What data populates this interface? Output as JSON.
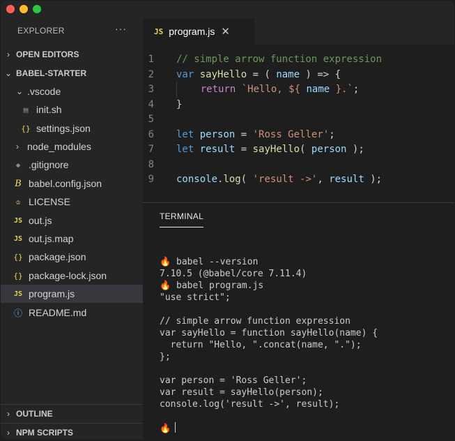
{
  "window": {
    "title_dots": [
      "close",
      "minimize",
      "maximize"
    ]
  },
  "sidebar": {
    "title": "EXPLORER",
    "more": "···",
    "sections": {
      "open_editors": "OPEN EDITORS",
      "project": "BABEL-STARTER",
      "outline": "OUTLINE",
      "npm_scripts": "NPM SCRIPTS"
    },
    "items": [
      {
        "label": ".vscode",
        "icon": "folder-open-chevron"
      },
      {
        "label": "init.sh",
        "icon": "shell-file-icon"
      },
      {
        "label": "settings.json",
        "icon": "json-icon"
      },
      {
        "label": "node_modules",
        "icon": "folder-closed-chevron"
      },
      {
        "label": ".gitignore",
        "icon": "git-icon"
      },
      {
        "label": "babel.config.json",
        "icon": "babel-icon"
      },
      {
        "label": "LICENSE",
        "icon": "license-icon"
      },
      {
        "label": "out.js",
        "icon": "js-icon"
      },
      {
        "label": "out.js.map",
        "icon": "js-icon"
      },
      {
        "label": "package.json",
        "icon": "json-icon"
      },
      {
        "label": "package-lock.json",
        "icon": "json-icon"
      },
      {
        "label": "program.js",
        "icon": "js-icon"
      },
      {
        "label": "README.md",
        "icon": "info-icon"
      }
    ],
    "icon_glyphs": {
      "js": "JS",
      "json": "{}",
      "chevron_down": "⌄",
      "chevron_right": "›",
      "info": "ⓘ"
    }
  },
  "editor": {
    "tab": {
      "label": "program.js",
      "close": "✕",
      "badge": "JS"
    },
    "line_numbers": [
      "1",
      "2",
      "3",
      "4",
      "5",
      "6",
      "7",
      "8",
      "9"
    ],
    "code": [
      "// simple arrow function expression",
      "var sayHello = ( name ) => {",
      "    return `Hello, ${ name }.`;",
      "}",
      "",
      "let person = 'Ross Geller';",
      "let result = sayHello( person );",
      "",
      "console.log( 'result ->', result );"
    ],
    "tokens": {
      "l1": "// simple arrow function expression",
      "l2_var": "var",
      "l2_name": "sayHello",
      "l2_eq": " = ( ",
      "l2_param": "name",
      "l2_rest": " ) => {",
      "l3_ret": "return",
      "l3_str1": "`Hello, ${",
      "l3_name": " name ",
      "l3_str2": "}.`",
      "l3_semi": ";",
      "l4": "}",
      "l6_let": "let",
      "l6_var": "person",
      "l6_eq": " = ",
      "l6_str": "'Ross Geller'",
      "l6_semi": ";",
      "l7_let": "let",
      "l7_var": "result",
      "l7_eq": " = ",
      "l7_fn": "sayHello",
      "l7_p1": "( ",
      "l7_arg": "person",
      "l7_p2": " );",
      "l9_obj": "console",
      "l9_dot": ".",
      "l9_fn": "log",
      "l9_p1": "( ",
      "l9_str": "'result ->'",
      "l9_comma": ", ",
      "l9_arg": "result",
      "l9_p2": " );"
    }
  },
  "terminal": {
    "tab": "TERMINAL",
    "prompt_icon": "🔥",
    "lines": [
      {
        "prompt": true,
        "text": " babel --version"
      },
      {
        "prompt": false,
        "text": "7.10.5 (@babel/core 7.11.4)"
      },
      {
        "prompt": true,
        "text": " babel program.js"
      },
      {
        "prompt": false,
        "text": "\"use strict\";"
      },
      {
        "prompt": false,
        "text": ""
      },
      {
        "prompt": false,
        "text": "// simple arrow function expression"
      },
      {
        "prompt": false,
        "text": "var sayHello = function sayHello(name) {"
      },
      {
        "prompt": false,
        "text": "  return \"Hello, \".concat(name, \".\");"
      },
      {
        "prompt": false,
        "text": "};"
      },
      {
        "prompt": false,
        "text": ""
      },
      {
        "prompt": false,
        "text": "var person = 'Ross Geller';"
      },
      {
        "prompt": false,
        "text": "var result = sayHello(person);"
      },
      {
        "prompt": false,
        "text": "console.log('result ->', result);"
      },
      {
        "prompt": false,
        "text": ""
      },
      {
        "prompt": true,
        "text": ""
      }
    ]
  }
}
